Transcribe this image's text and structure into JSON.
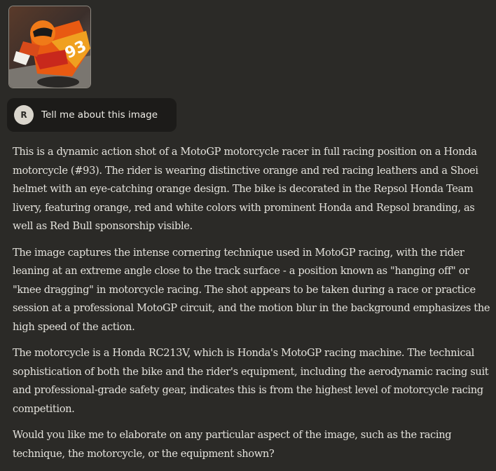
{
  "attachment": {
    "icon": "motogp-photo-thumbnail",
    "number_on_bike": "93"
  },
  "user_message": {
    "avatar_initial": "R",
    "text": "Tell me about this image"
  },
  "assistant_response": {
    "paragraphs": [
      "This is a dynamic action shot of a MotoGP motorcycle racer in full racing position on a Honda motorcycle (#93). The rider is wearing distinctive orange and red racing leathers and a Shoei helmet with an eye-catching orange design. The bike is decorated in the Repsol Honda Team livery, featuring orange, red and white colors with prominent Honda and Repsol branding, as well as Red Bull sponsorship visible.",
      "The image captures the intense cornering technique used in MotoGP racing, with the rider leaning at an extreme angle close to the track surface - a position known as \"hanging off\" or \"knee dragging\" in motorcycle racing. The shot appears to be taken during a race or practice session at a professional MotoGP circuit, and the motion blur in the background emphasizes the high speed of the action.",
      "The motorcycle is a Honda RC213V, which is Honda's MotoGP racing machine. The technical sophistication of both the bike and the rider's equipment, including the aerodynamic racing suit and professional-grade safety gear, indicates this is from the highest level of motorcycle racing competition.",
      "Would you like me to elaborate on any particular aspect of the image, such as the racing technique, the motorcycle, or the equipment shown?"
    ]
  },
  "colors": {
    "background": "#2b2a27",
    "user_bubble": "#1c1b19",
    "text": "#e4e2dc",
    "avatar": "#d9d5cc"
  }
}
